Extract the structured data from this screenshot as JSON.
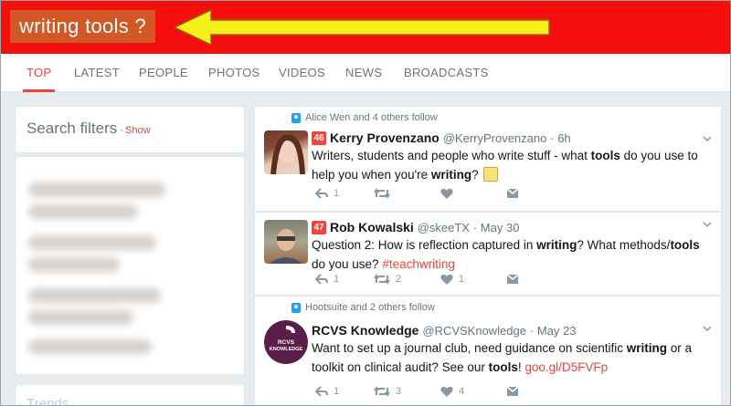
{
  "search": {
    "query": "writing tools ?"
  },
  "tabs": [
    {
      "label": "TOP",
      "active": true
    },
    {
      "label": "LATEST"
    },
    {
      "label": "PEOPLE"
    },
    {
      "label": "PHOTOS"
    },
    {
      "label": "VIDEOS"
    },
    {
      "label": "NEWS"
    },
    {
      "label": "BROADCASTS"
    }
  ],
  "filters": {
    "title": "Search filters",
    "show_label": "Show",
    "separator": "·"
  },
  "trends": {
    "label": "Trends"
  },
  "tweets": [
    {
      "context": "Alice Wen and 4 others follow",
      "rank": "46",
      "name": "Kerry Provenzano",
      "handle": "@KerryProvenzano",
      "time": "· 6h",
      "text_parts": [
        "Writers, students and people who write stuff - what ",
        "tools",
        " do you use to help you when you're ",
        "writing",
        "? "
      ],
      "actions": {
        "reply": "1",
        "retweet": "",
        "like": "",
        "dm": ""
      }
    },
    {
      "context": "",
      "rank": "47",
      "name": "Rob Kowalski",
      "handle": "@skeeTX",
      "time": "· May 30",
      "text_parts": [
        "Question 2:  How is reflection captured in ",
        "writing",
        "?  What methods/",
        "tools",
        " do you use? ",
        "#teachwriting"
      ],
      "actions": {
        "reply": "1",
        "retweet": "2",
        "like": "1",
        "dm": ""
      }
    },
    {
      "context": "Hootsuite and 2 others follow",
      "rank": "",
      "name": "RCVS Knowledge",
      "handle": "@RCVSKnowledge",
      "time": "· May 23",
      "text_parts": [
        "Want to set up a journal club, need guidance on scientific ",
        "writing",
        " or a toolkit on clinical audit? See our ",
        "tools",
        "! ",
        "goo.gl/D5FVFp"
      ],
      "actions": {
        "reply": "1",
        "retweet": "3",
        "like": "4",
        "dm": ""
      }
    }
  ],
  "avatar3_text": "RCVS KNOWLEDGE",
  "colors": {
    "topbar": "#f50f0c",
    "accent": "#f5423a",
    "arrow": "#f7f01b"
  }
}
